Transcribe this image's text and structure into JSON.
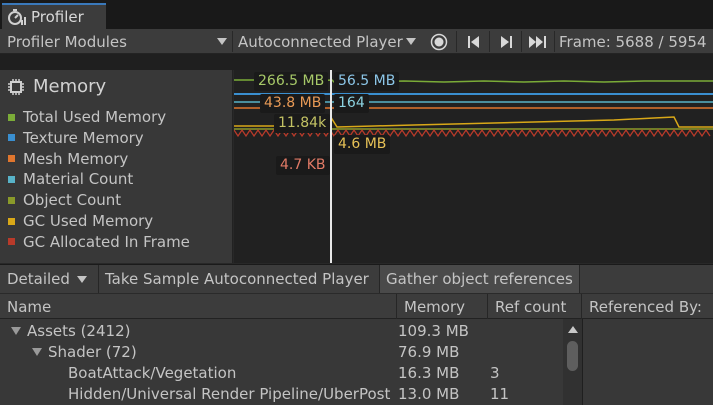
{
  "window": {
    "tab_title": "Profiler"
  },
  "toolbar": {
    "modules_label": "Profiler Modules",
    "target_label": "Autoconnected Player",
    "frame_label": "Frame: 5688 / 5954"
  },
  "legend": {
    "title": "Memory",
    "items": [
      {
        "label": "Total Used Memory",
        "color": "#7bac38"
      },
      {
        "label": "Texture Memory",
        "color": "#3a8fd0"
      },
      {
        "label": "Mesh Memory",
        "color": "#e0762e"
      },
      {
        "label": "Material Count",
        "color": "#58b3c8"
      },
      {
        "label": "Object Count",
        "color": "#8a9a2a"
      },
      {
        "label": "GC Used Memory",
        "color": "#d9a818"
      },
      {
        "label": "GC Allocated In Frame",
        "color": "#b83a2a"
      }
    ]
  },
  "chart_tooltips": {
    "total_used": "266.5 MB",
    "texture": "56.5 MB",
    "mesh": "43.8 MB",
    "material": "164",
    "object_count": "11.84k",
    "gc_used": "4.6 MB",
    "gc_alloc": "4.7 KB"
  },
  "bottom_toolbar": {
    "view_mode": "Detailed",
    "take_sample": "Take Sample Autoconnected Player",
    "gather": "Gather object references"
  },
  "columns": {
    "name": "Name",
    "memory": "Memory",
    "ref_count": "Ref count",
    "referenced_by": "Referenced By:"
  },
  "tree_rows": [
    {
      "name": "Assets (2412)",
      "memory": "109.3 MB",
      "ref": ""
    },
    {
      "name": "Shader (72)",
      "memory": "76.9 MB",
      "ref": ""
    },
    {
      "name": "BoatAttack/Vegetation",
      "memory": "16.3 MB",
      "ref": "3"
    },
    {
      "name": "Hidden/Universal Render Pipeline/UberPost",
      "memory": "13.0 MB",
      "ref": "11"
    }
  ]
}
